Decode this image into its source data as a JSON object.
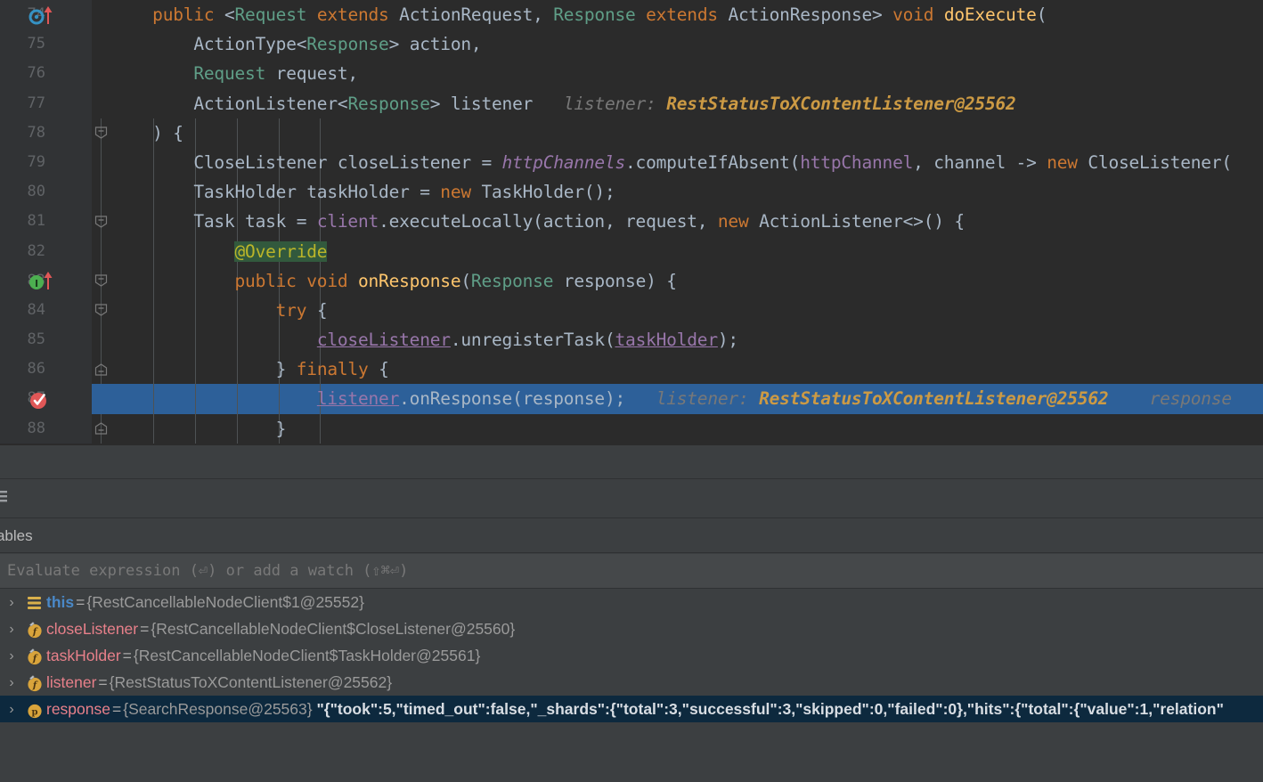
{
  "editor": {
    "lines": [
      {
        "number": "74",
        "gutter_icon": "override-method-icon",
        "fold": "none",
        "tokens": [
          {
            "t": "    ",
            "c": "plain"
          },
          {
            "t": "public ",
            "c": "kw"
          },
          {
            "t": "<",
            "c": "plain"
          },
          {
            "t": "Request",
            "c": "iface"
          },
          {
            "t": " extends ",
            "c": "kw"
          },
          {
            "t": "ActionRequest, ",
            "c": "cls"
          },
          {
            "t": "Response",
            "c": "iface"
          },
          {
            "t": " extends ",
            "c": "kw"
          },
          {
            "t": "ActionResponse> ",
            "c": "cls"
          },
          {
            "t": "void ",
            "c": "kw"
          },
          {
            "t": "doExecute",
            "c": "fn"
          },
          {
            "t": "(",
            "c": "plain"
          }
        ]
      },
      {
        "number": "75",
        "gutter_icon": "none",
        "fold": "none",
        "tokens": [
          {
            "t": "        ",
            "c": "plain"
          },
          {
            "t": "ActionType",
            "c": "cls"
          },
          {
            "t": "<",
            "c": "plain"
          },
          {
            "t": "Response",
            "c": "iface"
          },
          {
            "t": "> action,",
            "c": "plain"
          }
        ]
      },
      {
        "number": "76",
        "gutter_icon": "none",
        "fold": "none",
        "tokens": [
          {
            "t": "        ",
            "c": "plain"
          },
          {
            "t": "Request",
            "c": "iface"
          },
          {
            "t": " request,",
            "c": "plain"
          }
        ]
      },
      {
        "number": "77",
        "gutter_icon": "none",
        "fold": "none",
        "tokens": [
          {
            "t": "        ",
            "c": "plain"
          },
          {
            "t": "ActionListener",
            "c": "cls"
          },
          {
            "t": "<",
            "c": "plain"
          },
          {
            "t": "Response",
            "c": "iface"
          },
          {
            "t": "> listener",
            "c": "plain"
          },
          {
            "t": "   listener: ",
            "c": "hint"
          },
          {
            "t": "RestStatusToXContentListener@25562",
            "c": "hintv"
          }
        ]
      },
      {
        "number": "78",
        "gutter_icon": "none",
        "fold": "collapse-top",
        "tokens": [
          {
            "t": "    ) {",
            "c": "plain"
          }
        ]
      },
      {
        "number": "79",
        "gutter_icon": "none",
        "fold": "line",
        "tokens": [
          {
            "t": "        ",
            "c": "plain"
          },
          {
            "t": "CloseListener closeListener = ",
            "c": "plain"
          },
          {
            "t": "httpChannels",
            "c": "fldi"
          },
          {
            "t": ".computeIfAbsent(",
            "c": "plain"
          },
          {
            "t": "httpChannel",
            "c": "fld"
          },
          {
            "t": ", channel -> ",
            "c": "plain"
          },
          {
            "t": "new ",
            "c": "kw"
          },
          {
            "t": "CloseListener(",
            "c": "plain"
          }
        ]
      },
      {
        "number": "80",
        "gutter_icon": "none",
        "fold": "line",
        "tokens": [
          {
            "t": "        ",
            "c": "plain"
          },
          {
            "t": "TaskHolder taskHolder = ",
            "c": "plain"
          },
          {
            "t": "new ",
            "c": "kw"
          },
          {
            "t": "TaskHolder();",
            "c": "plain"
          }
        ]
      },
      {
        "number": "81",
        "gutter_icon": "none",
        "fold": "collapse-top",
        "tokens": [
          {
            "t": "        ",
            "c": "plain"
          },
          {
            "t": "Task task = ",
            "c": "plain"
          },
          {
            "t": "client",
            "c": "fld"
          },
          {
            "t": ".executeLocally(action, request, ",
            "c": "plain"
          },
          {
            "t": "new ",
            "c": "kw"
          },
          {
            "t": "ActionListener<>() {",
            "c": "plain"
          }
        ]
      },
      {
        "number": "82",
        "gutter_icon": "none",
        "fold": "line",
        "tokens": [
          {
            "t": "            ",
            "c": "plain"
          },
          {
            "t": "@Override",
            "c": "anno"
          }
        ]
      },
      {
        "number": "83",
        "gutter_icon": "implements-method-icon",
        "fold": "collapse-top",
        "tokens": [
          {
            "t": "            ",
            "c": "plain"
          },
          {
            "t": "public void ",
            "c": "kw"
          },
          {
            "t": "onResponse",
            "c": "fn"
          },
          {
            "t": "(",
            "c": "plain"
          },
          {
            "t": "Response",
            "c": "iface"
          },
          {
            "t": " response) {",
            "c": "plain"
          }
        ]
      },
      {
        "number": "84",
        "gutter_icon": "none",
        "fold": "collapse-top",
        "tokens": [
          {
            "t": "                ",
            "c": "plain"
          },
          {
            "t": "try ",
            "c": "kw"
          },
          {
            "t": "{",
            "c": "plain"
          }
        ]
      },
      {
        "number": "85",
        "gutter_icon": "none",
        "fold": "line",
        "tokens": [
          {
            "t": "                    ",
            "c": "plain"
          },
          {
            "t": "closeListener",
            "c": "fld und"
          },
          {
            "t": ".unregisterTask(",
            "c": "plain"
          },
          {
            "t": "taskHolder",
            "c": "fld und"
          },
          {
            "t": ");",
            "c": "plain"
          }
        ]
      },
      {
        "number": "86",
        "gutter_icon": "none",
        "fold": "collapse-bottom",
        "tokens": [
          {
            "t": "                ",
            "c": "plain"
          },
          {
            "t": "} ",
            "c": "plain"
          },
          {
            "t": "finally ",
            "c": "kw"
          },
          {
            "t": "{",
            "c": "plain"
          }
        ]
      },
      {
        "number": "87",
        "gutter_icon": "breakpoint-verified-icon",
        "fold": "none",
        "highlighted": true,
        "tokens": [
          {
            "t": "                    ",
            "c": "plain"
          },
          {
            "t": "listener",
            "c": "fld und"
          },
          {
            "t": ".onResponse(response);",
            "c": "plain"
          },
          {
            "t": "   listener: ",
            "c": "hint"
          },
          {
            "t": "RestStatusToXContentListener@25562",
            "c": "hintv"
          },
          {
            "t": "    response",
            "c": "hint"
          }
        ]
      },
      {
        "number": "88",
        "gutter_icon": "none",
        "fold": "collapse-bottom",
        "tokens": [
          {
            "t": "                ",
            "c": "plain"
          },
          {
            "t": "}",
            "c": "plain"
          }
        ]
      }
    ]
  },
  "frames_toolbar": {
    "icon": "frames-list-icon"
  },
  "variables_panel": {
    "title": "Variables",
    "evaluate_placeholder": "Evaluate expression (⏎) or add a watch (⇧⌘⏎)",
    "rows": [
      {
        "expander": "›",
        "icon": "value-stack-icon",
        "name": "this",
        "name_kind": "this",
        "eq": "=",
        "value": "{RestCancellableNodeClient$1@25552}",
        "string_value": "",
        "selected": false
      },
      {
        "expander": "›",
        "icon": "field-icon",
        "name": "closeListener",
        "name_kind": "field",
        "eq": "=",
        "value": "{RestCancellableNodeClient$CloseListener@25560}",
        "string_value": "",
        "selected": false
      },
      {
        "expander": "›",
        "icon": "field-icon",
        "name": "taskHolder",
        "name_kind": "field",
        "eq": "=",
        "value": "{RestCancellableNodeClient$TaskHolder@25561}",
        "string_value": "",
        "selected": false
      },
      {
        "expander": "›",
        "icon": "field-icon",
        "name": "listener",
        "name_kind": "field",
        "eq": "=",
        "value": "{RestStatusToXContentListener@25562}",
        "string_value": "",
        "selected": false
      },
      {
        "expander": "›",
        "icon": "parameter-icon",
        "name": "response",
        "name_kind": "parameter",
        "eq": "=",
        "value": "{SearchResponse@25563}",
        "string_value": "\"{\"took\":5,\"timed_out\":false,\"_shards\":{\"total\":3,\"successful\":3,\"skipped\":0,\"failed\":0},\"hits\":{\"total\":{\"value\":1,\"relation\"",
        "selected": true
      }
    ]
  },
  "colors": {
    "editor_background": "#2b2b2b",
    "gutter_background": "#313335",
    "panel_background": "#3c3f41",
    "selection_highlight": "#2d6099",
    "row_selected": "#0d293e",
    "keyword": "#cc7832",
    "method": "#ffc66d",
    "field": "#9876aa",
    "interface": "#5f9e87",
    "text": "#a9b7c6",
    "inlay_hint": "#787878",
    "inlay_value": "#cc9a44",
    "annotation_text": "#bbb529",
    "annotation_bg": "#32593d",
    "breakpoint": "#e05757",
    "variable_name": "#e8808a",
    "variable_value": "#9a9a9a"
  }
}
